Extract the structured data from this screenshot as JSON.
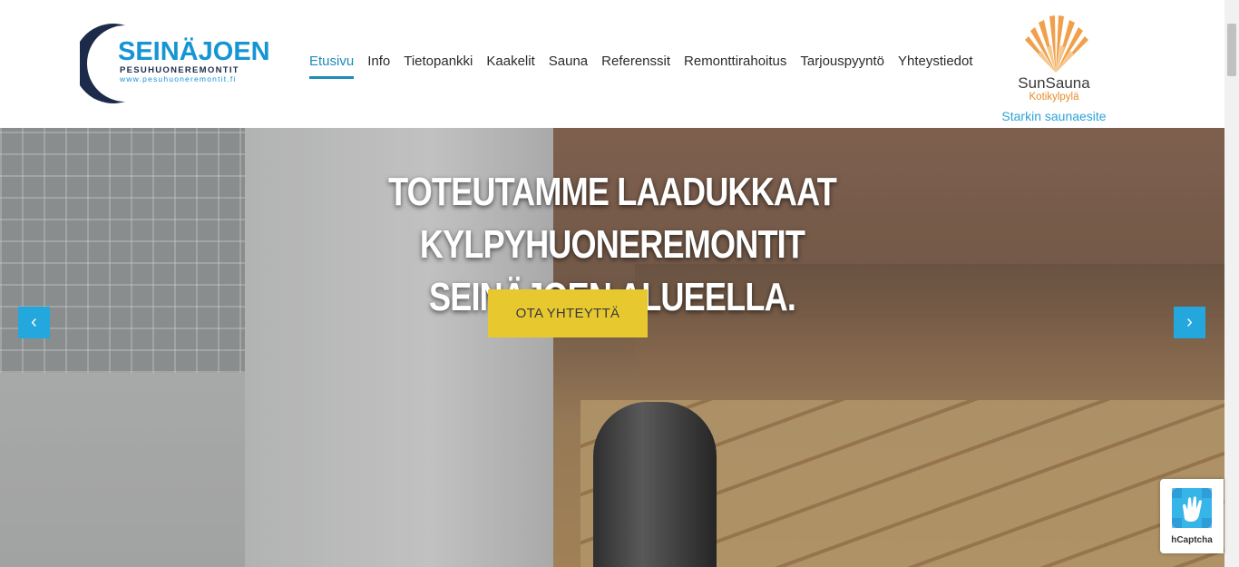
{
  "logo": {
    "title": "SEINÄJOEN",
    "subtitle": "PESUHUONEREMONTIT",
    "url": "www.pesuhuoneremontit.fi"
  },
  "nav": {
    "items": [
      {
        "label": "Etusivu",
        "active": true
      },
      {
        "label": "Info"
      },
      {
        "label": "Tietopankki"
      },
      {
        "label": "Kaakelit"
      },
      {
        "label": "Sauna"
      },
      {
        "label": "Referenssit"
      },
      {
        "label": "Remonttirahoitus"
      },
      {
        "label": "Tarjouspyyntö"
      },
      {
        "label": "Yhteystiedot"
      }
    ]
  },
  "partner": {
    "name": "SunSauna",
    "sub": "Kotikylpylä",
    "tagline": "Starkin saunaesite"
  },
  "hero": {
    "title_line1": "TOTEUTAMME LAADUKKAAT KYLPYHUONEREMONTIT",
    "title_line2": "SEINÄJOEN ALUEELLA.",
    "cta": "OTA YHTEYTTÄ",
    "prev_icon": "chevron-left-icon",
    "next_icon": "chevron-right-icon"
  },
  "captcha": {
    "label": "hCaptcha"
  },
  "colors": {
    "accent": "#1e8bb8",
    "brand_blue": "#1595d3",
    "cta": "#e7c92f",
    "arrow": "#23a7dc"
  }
}
